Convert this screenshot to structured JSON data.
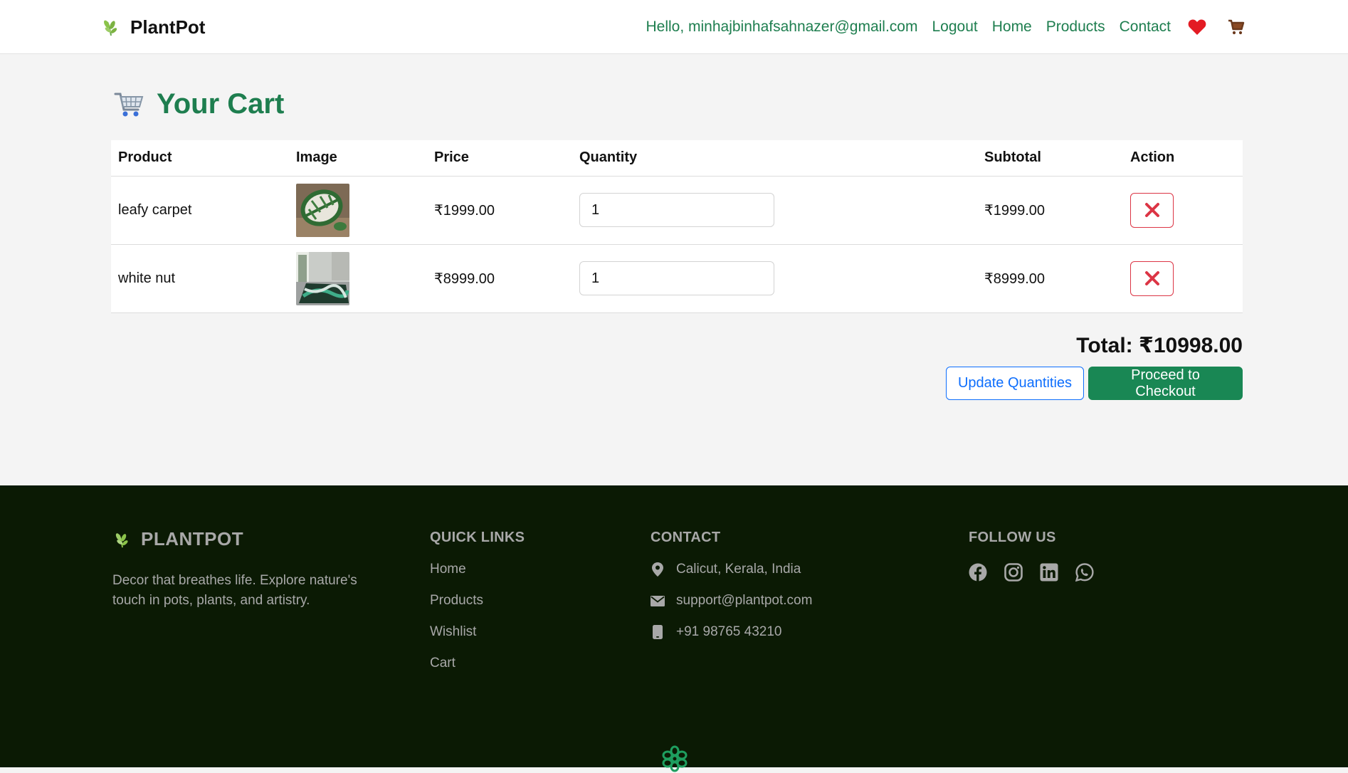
{
  "navbar": {
    "brand": "PlantPot",
    "greeting": "Hello, minhajbinhafsahnazer@gmail.com",
    "links": [
      "Logout",
      "Home",
      "Products",
      "Contact"
    ],
    "icons": [
      "heart-icon",
      "cart-icon"
    ],
    "colors": {
      "link": "#1e7e4f",
      "heart": "#e31b23",
      "cart": "#6b3a1e"
    }
  },
  "cart": {
    "title": "Your Cart",
    "headers": [
      "Product",
      "Image",
      "Price",
      "Quantity",
      "Subtotal",
      "Action"
    ],
    "items": [
      {
        "product": "leafy carpet",
        "price": "₹1999.00",
        "quantity": "1",
        "subtotal": "₹1999.00"
      },
      {
        "product": "white nut",
        "price": "₹8999.00",
        "quantity": "1",
        "subtotal": "₹8999.00"
      }
    ],
    "total": "Total: ₹10998.00",
    "update_label": "Update Quantities",
    "checkout_label": "Proceed to Checkout"
  },
  "footer": {
    "brand": "PLANTPOT",
    "description": "Decor that breathes life. Explore nature's touch in pots, plants, and artistry.",
    "quick_links": {
      "heading": "QUICK LINKS",
      "items": [
        "Home",
        "Products",
        "Wishlist",
        "Cart"
      ]
    },
    "contact": {
      "heading": "CONTACT",
      "address": "Calicut, Kerala, India",
      "email": "support@plantpot.com",
      "phone": "+91 98765 43210"
    },
    "follow": {
      "heading": "FOLLOW US",
      "icons": [
        "facebook-icon",
        "instagram-icon",
        "linkedin-icon",
        "whatsapp-icon"
      ]
    }
  }
}
